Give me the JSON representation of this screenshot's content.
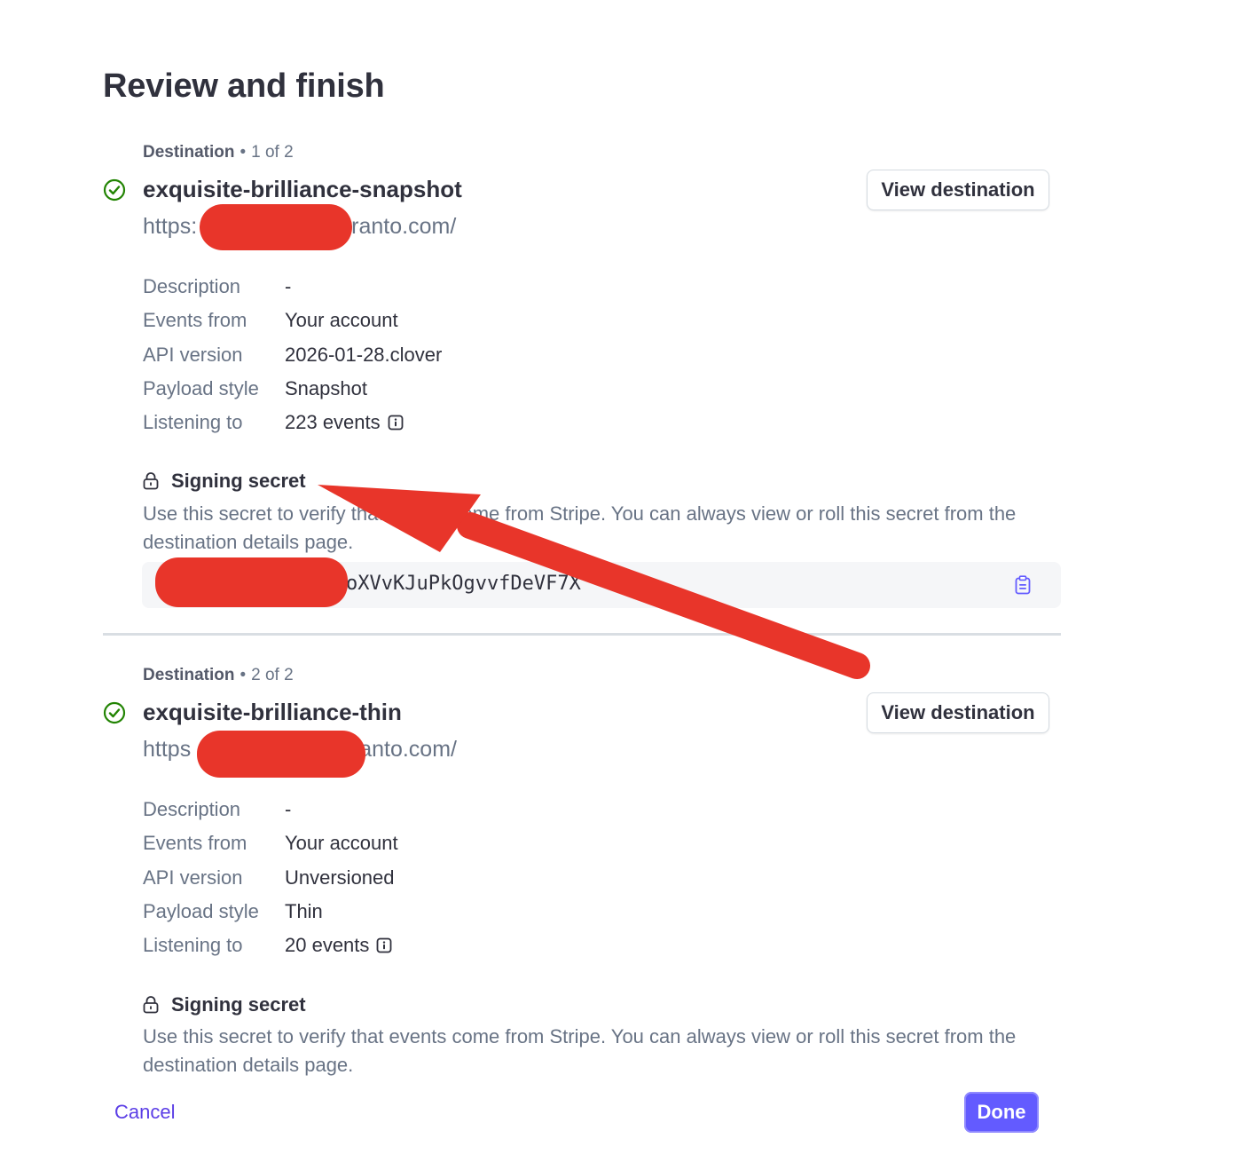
{
  "page": {
    "title": "Review and finish"
  },
  "destinations": [
    {
      "label": "Destination",
      "position": "1 of 2",
      "name": "exquisite-brilliance-snapshot",
      "url_prefix": "https:",
      "url_suffix": "ranto.com/",
      "view_button": "View destination",
      "details": [
        {
          "key": "Description",
          "value": "-"
        },
        {
          "key": "Events from",
          "value": "Your account"
        },
        {
          "key": "API version",
          "value": "2026-01-28.clover"
        },
        {
          "key": "Payload style",
          "value": "Snapshot"
        },
        {
          "key": "Listening to",
          "value": "223 events"
        }
      ],
      "secret_title": "Signing secret",
      "secret_desc": "Use this secret to verify that events come from Stripe. You can always view or roll this secret from the destination details page.",
      "secret_value_visible": "oXVvKJuPkOgvvfDeVF7X"
    },
    {
      "label": "Destination",
      "position": "2 of 2",
      "name": "exquisite-brilliance-thin",
      "url_prefix": "https",
      "url_suffix": "anto.com/",
      "view_button": "View destination",
      "details": [
        {
          "key": "Description",
          "value": "-"
        },
        {
          "key": "Events from",
          "value": "Your account"
        },
        {
          "key": "API version",
          "value": "Unversioned"
        },
        {
          "key": "Payload style",
          "value": "Thin"
        },
        {
          "key": "Listening to",
          "value": "20 events"
        }
      ],
      "secret_title": "Signing secret",
      "secret_desc": "Use this secret to verify that events come from Stripe. You can always view or roll this secret from the destination details page."
    }
  ],
  "footer": {
    "cancel": "Cancel",
    "done": "Done"
  },
  "icons": {
    "check": "check-circle-icon",
    "lock": "lock-icon",
    "info": "info-icon",
    "copy": "clipboard-icon"
  },
  "colors": {
    "accent": "#635bff",
    "link": "#5b3ee6",
    "success": "#228403",
    "annotation_red": "#e8352a"
  }
}
